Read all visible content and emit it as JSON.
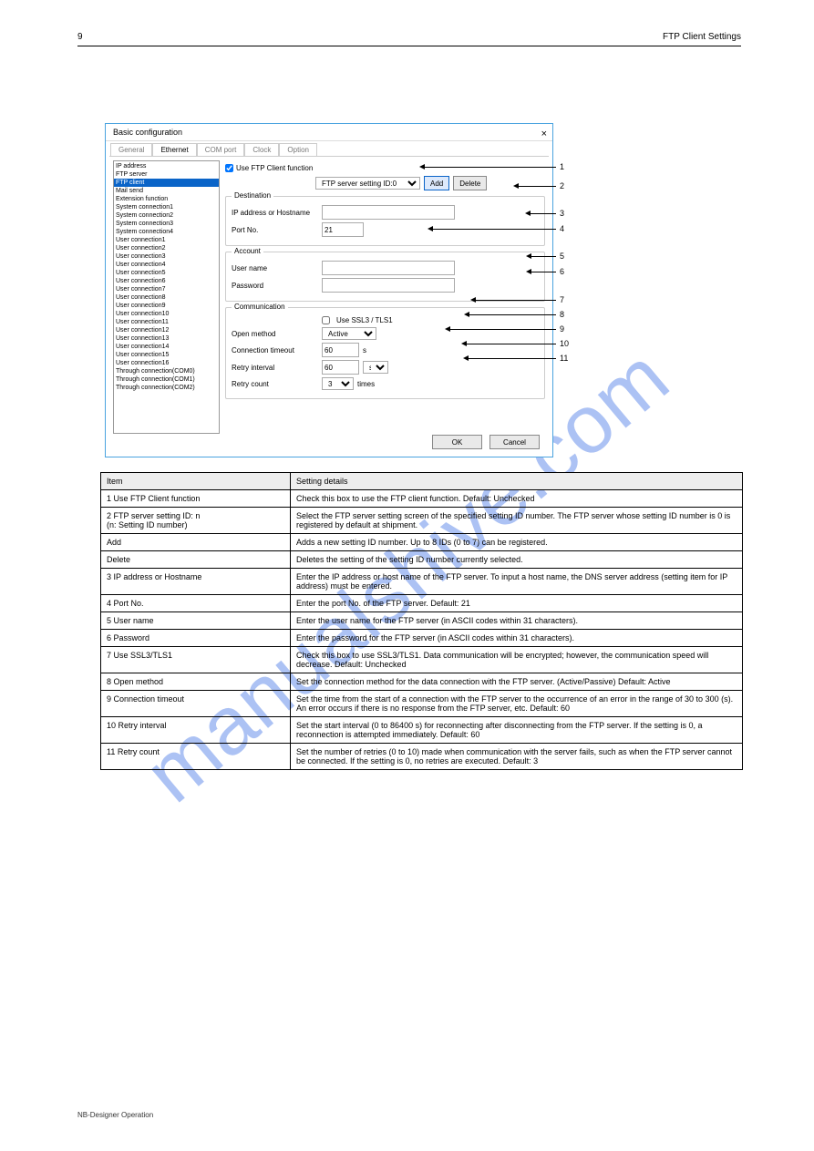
{
  "header": {
    "left": "9",
    "right": "FTP Client Settings"
  },
  "dialog": {
    "title": "Basic configuration",
    "tabs": [
      "General",
      "Ethernet",
      "COM port",
      "Clock",
      "Option"
    ],
    "active_tab": 1,
    "list": [
      "IP address",
      "FTP server",
      "FTP client",
      "Mail send",
      "Extension function",
      "System connection1",
      "System connection2",
      "System connection3",
      "System connection4",
      "User connection1",
      "User connection2",
      "User connection3",
      "User connection4",
      "User connection5",
      "User connection6",
      "User connection7",
      "User connection8",
      "User connection9",
      "User connection10",
      "User connection11",
      "User connection12",
      "User connection13",
      "User connection14",
      "User connection15",
      "User connection16",
      "Through connection(COM0)",
      "Through connection(COM1)",
      "Through connection(COM2)"
    ],
    "selected_index": 2,
    "use_ftp_checked": true,
    "use_ftp_label": "Use FTP Client function",
    "ftp_setting_label": "FTP server setting ID:0",
    "add_label": "Add",
    "delete_label": "Delete",
    "dest_title": "Destination",
    "ip_label": "IP address or Hostname",
    "ip_value": "",
    "port_label": "Port No.",
    "port_value": "21",
    "acct_title": "Account",
    "user_label": "User name",
    "user_value": "",
    "pass_label": "Password",
    "pass_value": "",
    "comm_title": "Communication",
    "ssl_checked": false,
    "ssl_label": "Use SSL3 / TLS1",
    "open_label": "Open method",
    "open_value": "Active",
    "timeout_label": "Connection timeout",
    "timeout_value": "60",
    "timeout_unit": "s",
    "retry_int_label": "Retry interval",
    "retry_int_value": "60",
    "retry_int_unit": "s",
    "retry_cnt_label": "Retry count",
    "retry_cnt_value": "3",
    "retry_cnt_unit": "times",
    "ok": "OK",
    "cancel": "Cancel"
  },
  "callouts": [
    "1",
    "2",
    "3",
    "4",
    "5",
    "6",
    "7",
    "8",
    "9",
    "10",
    "11"
  ],
  "table": {
    "h1": "Item",
    "h2": "Setting details",
    "rows": [
      {
        "c1": "1 Use FTP Client function",
        "c2": "Check this box to use the FTP client function. Default: Unchecked"
      },
      {
        "c1": "2 FTP server setting ID: n\n(n: Setting ID number)",
        "c2": "Select the FTP server setting screen of the specified setting ID number. The FTP server whose setting ID number is 0 is registered by default at shipment."
      },
      {
        "c1": "Add",
        "c2": "Adds a new setting ID number. Up to 8 IDs (0 to 7) can be registered."
      },
      {
        "c1": "Delete",
        "c2": "Deletes the setting of the setting ID number currently selected."
      },
      {
        "c1": "3 IP address or Hostname",
        "c2": "Enter the IP address or host name of the FTP server. To input a host name, the DNS server address (setting item for IP address) must be entered."
      },
      {
        "c1": "4 Port No.",
        "c2": "Enter the port No. of the FTP server. Default: 21"
      },
      {
        "c1": "5 User name",
        "c2": "Enter the user name for the FTP server (in ASCII codes within 31 characters)."
      },
      {
        "c1": "6 Password",
        "c2": "Enter the password for the FTP server (in ASCII codes within 31 characters)."
      },
      {
        "c1": "7 Use SSL3/TLS1",
        "c2": "Check this box to use SSL3/TLS1. Data communication will be encrypted; however, the communication speed will decrease. Default: Unchecked"
      },
      {
        "c1": "8 Open method",
        "c2": "Set the connection method for the data connection with the FTP server. (Active/Passive) Default: Active"
      },
      {
        "c1": "9 Connection timeout",
        "c2": "Set the time from the start of a connection with the FTP server to the occurrence of an error in the range of 30 to 300 (s). An error occurs if there is no response from the FTP server, etc. Default: 60"
      },
      {
        "c1": "10 Retry interval",
        "c2": "Set the start interval (0 to 86400 s) for reconnecting after disconnecting from the FTP server. If the setting is 0, a reconnection is attempted immediately. Default: 60"
      },
      {
        "c1": "11 Retry count",
        "c2": "Set the number of retries (0 to 10) made when communication with the server fails, such as when the FTP server cannot be connected. If the setting is 0, no retries are executed. Default: 3"
      }
    ]
  },
  "footer": "NB-Designer Operation"
}
